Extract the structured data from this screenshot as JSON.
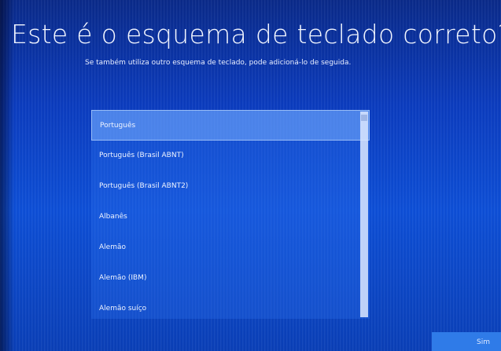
{
  "header": {
    "title": "Este é o esquema de teclado correto?",
    "subtitle": "Se também utiliza outro esquema de teclado, pode adicioná-lo de seguida."
  },
  "layouts": {
    "selected_index": 0,
    "items": [
      {
        "label": "Português"
      },
      {
        "label": "Português (Brasil ABNT)"
      },
      {
        "label": "Português (Brasil ABNT2)"
      },
      {
        "label": "Albanês"
      },
      {
        "label": "Alemão"
      },
      {
        "label": "Alemão (IBM)"
      },
      {
        "label": "Alemão suíço"
      }
    ]
  },
  "footer": {
    "next_label": "Sim"
  },
  "colors": {
    "background": "#0b3cc0",
    "selection": "#78afff",
    "button": "#2f7be8"
  }
}
